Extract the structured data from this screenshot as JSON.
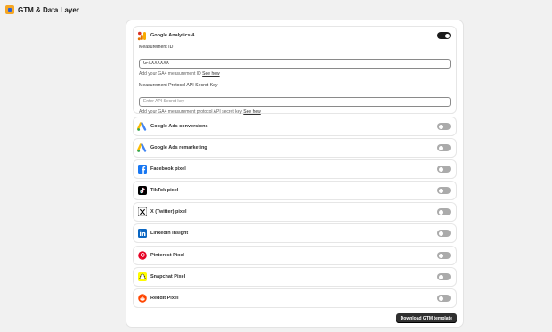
{
  "app": {
    "title": "GTM & Data Layer",
    "icon": "gtm-app-icon"
  },
  "integrations": [
    {
      "key": "ga4",
      "label": "Google Analytics 4",
      "enabled": true,
      "icon": "google-analytics-icon"
    },
    {
      "key": "gads_conv",
      "label": "Google Ads conversions",
      "enabled": false,
      "icon": "google-ads-icon"
    },
    {
      "key": "gads_remark",
      "label": "Google Ads remarketing",
      "enabled": false,
      "icon": "google-ads-icon"
    },
    {
      "key": "facebook",
      "label": "Facebook pixel",
      "enabled": false,
      "icon": "facebook-icon"
    },
    {
      "key": "tiktok",
      "label": "TikTok pixel",
      "enabled": false,
      "icon": "tiktok-icon"
    },
    {
      "key": "x",
      "label": "X (Twitter) pixel",
      "enabled": false,
      "icon": "x-icon"
    },
    {
      "key": "linkedin",
      "label": "LinkedIn insight",
      "enabled": false,
      "icon": "linkedin-icon"
    },
    {
      "key": "pinterest",
      "label": "Pinterest Pixel",
      "enabled": false,
      "icon": "pinterest-icon"
    },
    {
      "key": "snapchat",
      "label": "Snapchat Pixel",
      "enabled": false,
      "icon": "snapchat-icon"
    },
    {
      "key": "reddit",
      "label": "Reddit Pixel",
      "enabled": false,
      "icon": "reddit-icon"
    }
  ],
  "ga4": {
    "measurement_id": {
      "label": "Measurement ID",
      "value": "G-XXXXXXX",
      "help": "Add your GA4 measurement ID",
      "help_link": "See how"
    },
    "api_secret": {
      "label": "Measurement Protocol API Secret Key",
      "placeholder": "Enter API Secret key",
      "value": "",
      "help": "Add your GA4 measurement protocol API secret key",
      "help_link": "See how"
    }
  },
  "actions": {
    "download_label": "Download GTM template"
  },
  "colors": {
    "background": "#f1f1f1",
    "toggle_on": "#1a1a1a",
    "toggle_off": "#ababab",
    "primary_button": "#303030"
  }
}
